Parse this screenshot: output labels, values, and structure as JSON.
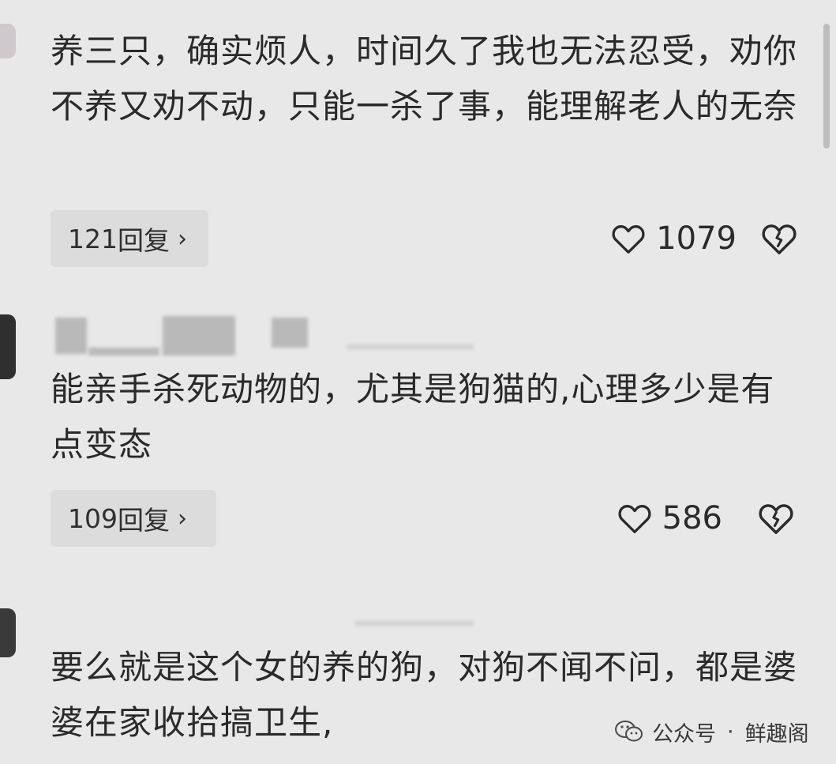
{
  "comments": [
    {
      "text": "养三只，确实烦人，时间久了我也无法忍受，劝你不养又劝不动，只能一杀了事，能理解老人的无奈",
      "reply_count": "121",
      "reply_label": "回复",
      "likes": "1079"
    },
    {
      "text": "能亲手杀死动物的，尤其是狗猫的,心理多少是有点变态",
      "reply_count": "109",
      "reply_label": "回复",
      "likes": "586"
    },
    {
      "text": "要么就是这个女的养的狗，对狗不闻不问，都是婆婆在家收拾搞卫生,",
      "reply_count": "",
      "reply_label": "",
      "likes": ""
    }
  ],
  "watermark": {
    "icon": "wechat-icon",
    "source": "公众号",
    "separator": "·",
    "account": "鲜趣阁"
  },
  "colors": {
    "background": "#e8e8e8",
    "text": "#2a2a2a",
    "pill": "#dcdcdc"
  }
}
